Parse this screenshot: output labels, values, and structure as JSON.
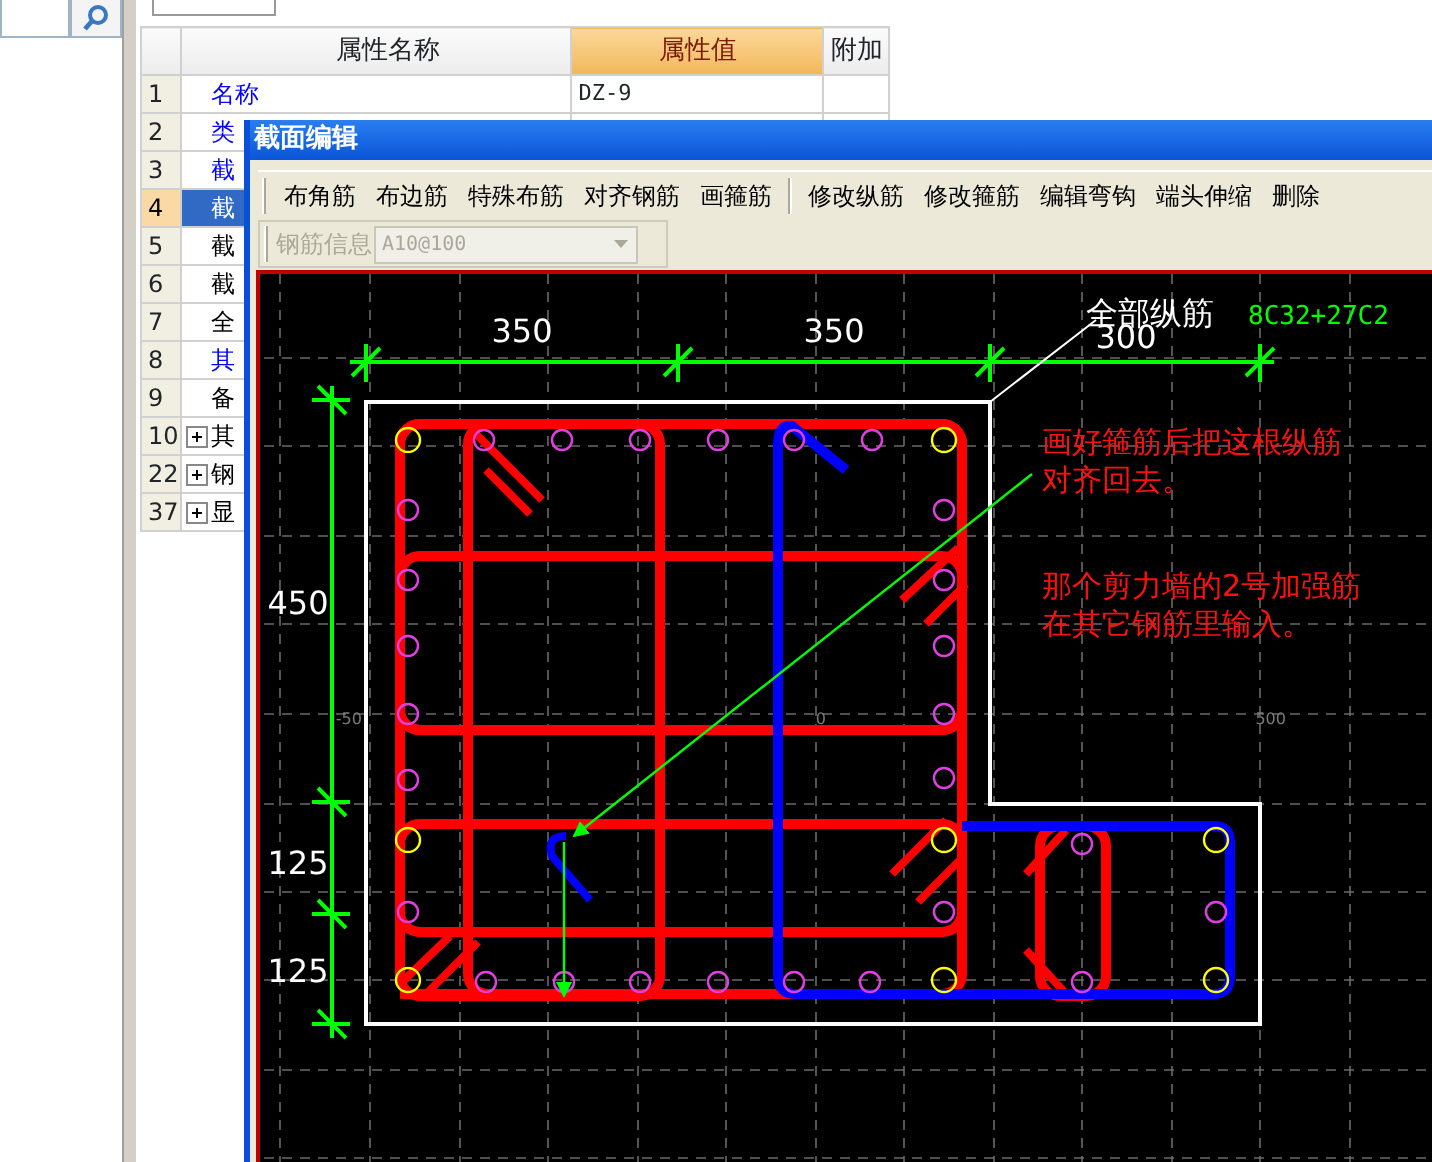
{
  "property_table": {
    "columns": [
      {
        "label": "属性名称",
        "selected": false
      },
      {
        "label": "属性值",
        "selected": true
      },
      {
        "label": "附加",
        "selected": false
      }
    ],
    "rows": [
      {
        "number": "1",
        "name": "名称",
        "value": "DZ-9",
        "color": "#0000ff",
        "kind": "property",
        "selected": false
      },
      {
        "number": "2",
        "name": "类",
        "color": "#0000ff",
        "kind": "property",
        "selected": false
      },
      {
        "number": "3",
        "name": "截",
        "color": "#0000ff",
        "kind": "property",
        "selected": false
      },
      {
        "number": "4",
        "name": "截",
        "color": "#ffffff",
        "kind": "property",
        "selected": true
      },
      {
        "number": "5",
        "name": "截",
        "color": "#000000",
        "kind": "property",
        "selected": false
      },
      {
        "number": "6",
        "name": "截",
        "color": "#000000",
        "kind": "property",
        "selected": false
      },
      {
        "number": "7",
        "name": "全",
        "color": "#000000",
        "kind": "property",
        "selected": false
      },
      {
        "number": "8",
        "name": "其",
        "color": "#0000ff",
        "kind": "property",
        "selected": false
      },
      {
        "number": "9",
        "name": "备",
        "color": "#000000",
        "kind": "property",
        "selected": false
      },
      {
        "number": "10",
        "name": "其",
        "color": "#000000",
        "kind": "group",
        "expanded": false,
        "selected": false
      },
      {
        "number": "22",
        "name": "钢",
        "color": "#000000",
        "kind": "group",
        "expanded": false,
        "selected": false
      },
      {
        "number": "37",
        "name": "显",
        "color": "#000000",
        "kind": "group",
        "expanded": false,
        "selected": false
      }
    ]
  },
  "dialog": {
    "title": "截面编辑",
    "toolbar_groups": [
      [
        "布角筋",
        "布边筋",
        "特殊布筋",
        "对齐钢筋",
        "画箍筋"
      ],
      [
        "修改纵筋",
        "修改箍筋",
        "编辑弯钩",
        "端头伸缩",
        "删除"
      ]
    ],
    "rebar_info": {
      "label": "钢筋信息",
      "value": "A10@100",
      "disabled": true
    },
    "canvas": {
      "grid_labels": [
        "-50",
        "0",
        "500"
      ],
      "top_dimensions": [
        "350",
        "350",
        "300"
      ],
      "left_dimensions": [
        "450",
        "125",
        "125"
      ],
      "leader_label": "全部纵筋",
      "rebar_spec": "8C32+27C2",
      "notes": [
        {
          "lines": [
            "画好箍筋后把这根纵筋",
            "对齐回去。"
          ]
        },
        {
          "lines": [
            "那个剪力墙的2号加强筋",
            "在其它钢筋里输入。"
          ]
        }
      ]
    }
  }
}
